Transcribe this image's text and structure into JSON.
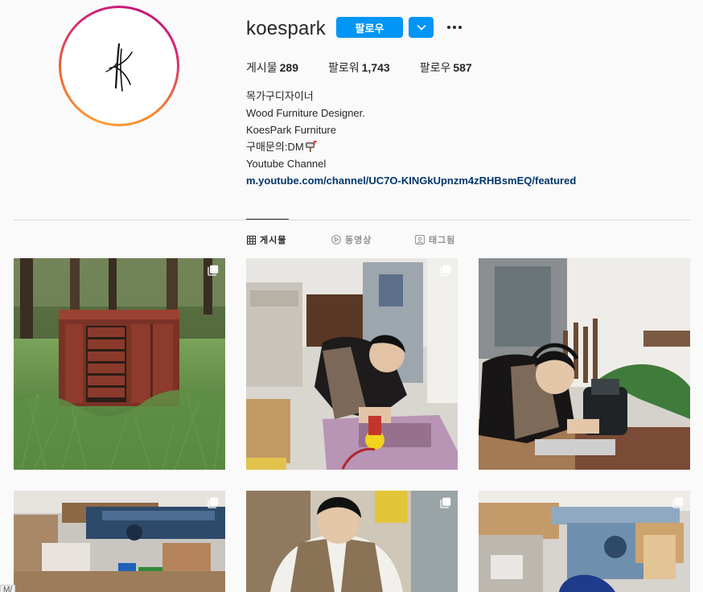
{
  "profile": {
    "username": "koespark",
    "follow_label": "팔로우",
    "stats": [
      {
        "label": "게시물",
        "value": "289"
      },
      {
        "label": "팔로워",
        "value": "1,743"
      },
      {
        "label": "팔로우",
        "value": "587"
      }
    ],
    "bio": {
      "name_line": "목가구디자이너",
      "line2": "Wood Furniture Designer.",
      "line3": "KoesPark Furniture",
      "line4": "구매문의:DM",
      "line5": "Youtube Channel",
      "link": "m.youtube.com/channel/UC7O-KINGkUpnzm4zRHBsmEQ/featured"
    }
  },
  "tabs": [
    {
      "label": "게시물",
      "icon": "grid-icon",
      "active": true
    },
    {
      "label": "동영상",
      "icon": "play-circle-icon",
      "active": false
    },
    {
      "label": "태그됨",
      "icon": "tag-person-icon",
      "active": false
    }
  ],
  "posts": [
    {
      "name": "post-wooden-cabinet-in-grass",
      "multi": true
    },
    {
      "name": "post-sanding-workshop",
      "multi": true
    },
    {
      "name": "post-routing-workshop",
      "multi": false
    },
    {
      "name": "post-workshop-tables",
      "multi": true
    },
    {
      "name": "post-man-in-apron",
      "multi": true
    },
    {
      "name": "post-workshop-table-saw",
      "multi": true
    }
  ],
  "status_tip": "M/",
  "colors": {
    "accent": "#0095f6",
    "link": "#00376b",
    "text": "#262626",
    "muted": "#8e8e8e",
    "divider": "#dbdbdb",
    "background": "#fafafa"
  }
}
